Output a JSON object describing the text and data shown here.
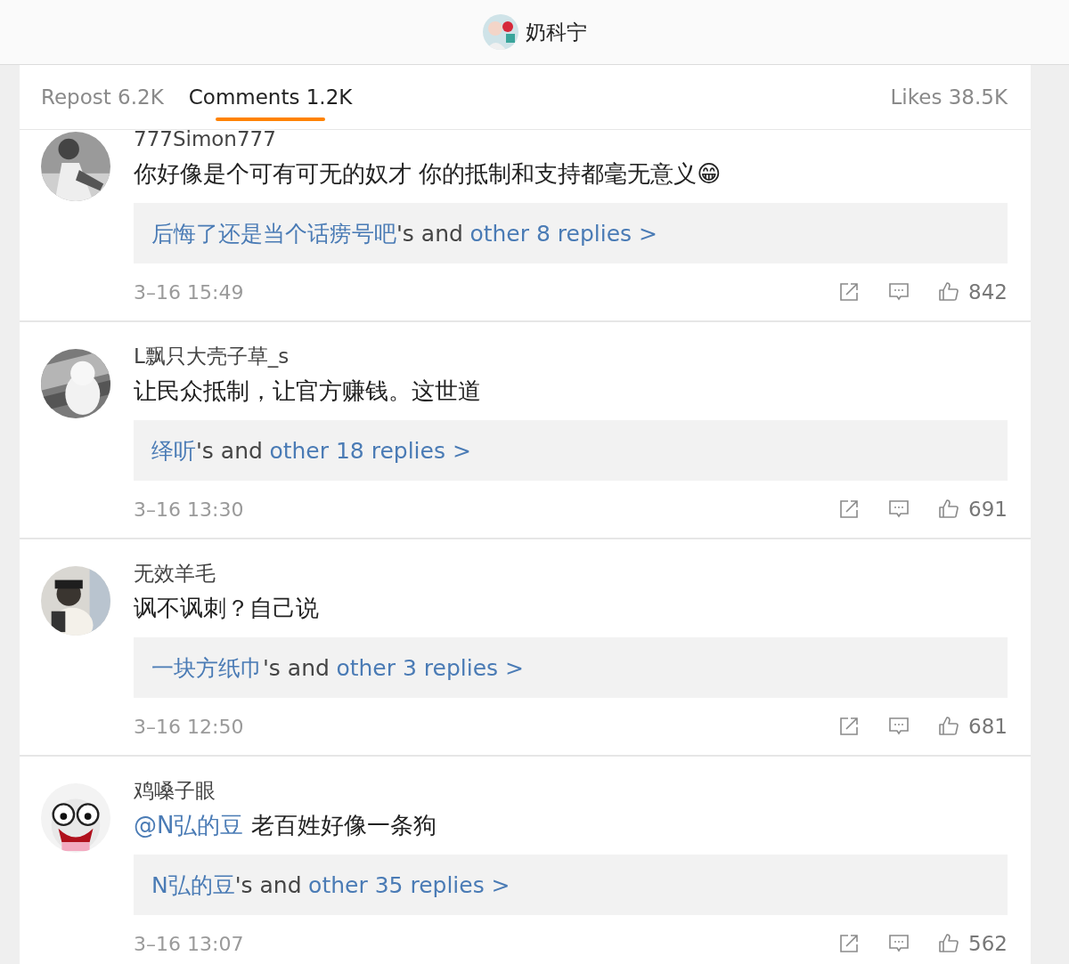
{
  "header": {
    "title": "奶科宁"
  },
  "tabs": [
    {
      "label": "Repost 6.2K",
      "selected": false,
      "kind": "left"
    },
    {
      "label": "Comments 1.2K",
      "selected": true,
      "kind": "left"
    },
    {
      "label": "Likes 38.5K",
      "selected": false,
      "kind": "right"
    }
  ],
  "comments": [
    {
      "user": "777Simon777",
      "text": "你好像是个可有可无的奴才 你的抵制和支持都毫无意义😁",
      "reply_author": "后悔了还是当个话痨号吧",
      "reply_middle": "'s and",
      "reply_link": "other 8 replies >",
      "time": "3–16 15:49",
      "likes": "842"
    },
    {
      "user": "L飘只大壳子草_s",
      "text": "让民众抵制，让官方赚钱。这世道",
      "reply_author": "绎听",
      "reply_middle": "'s and",
      "reply_link": "other 18 replies >",
      "time": "3–16 13:30",
      "likes": "691"
    },
    {
      "user": "无效羊毛",
      "text": "讽不讽刺？自己说",
      "reply_author": "一块方纸巾",
      "reply_middle": "'s and",
      "reply_link": "other 3 replies >",
      "time": "3–16 12:50",
      "likes": "681"
    },
    {
      "user": "鸡嗓子眼",
      "mention": "@N弘的豆",
      "text": "老百姓好像一条狗",
      "reply_author": "N弘的豆",
      "reply_middle": "'s and",
      "reply_link": "other 35 replies >",
      "time": "3–16 13:07",
      "likes": "562"
    }
  ]
}
